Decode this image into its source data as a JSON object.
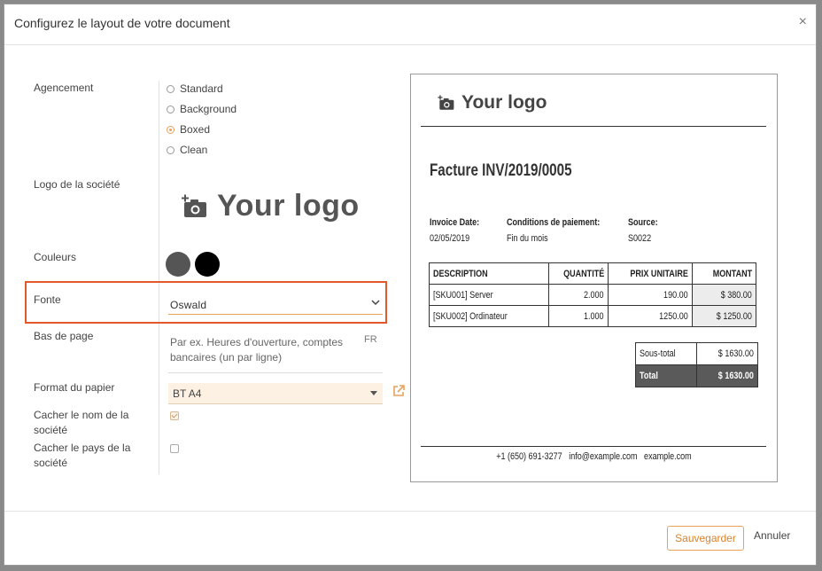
{
  "modal": {
    "title": "Configurez le layout de votre document",
    "close_icon": "×"
  },
  "form": {
    "layout": {
      "label": "Agencement",
      "options": [
        "Standard",
        "Background",
        "Boxed",
        "Clean"
      ],
      "selected": "Boxed"
    },
    "logo": {
      "label": "Logo de la société",
      "text": "Your logo",
      "icon": "camera-plus-icon"
    },
    "colors": {
      "label": "Couleurs",
      "primary": "#555555",
      "secondary": "#000000"
    },
    "font": {
      "label": "Fonte",
      "value": "Oswald"
    },
    "footer": {
      "label": "Bas de page",
      "placeholder": "Par ex. Heures d'ouverture, comptes bancaires (un par ligne)",
      "lang": "FR"
    },
    "paper_format": {
      "label": "Format du papier",
      "value": "BT A4"
    },
    "hide_company_name": {
      "label": "Cacher le nom de la société",
      "checked": true
    },
    "hide_company_country": {
      "label": "Cacher le pays de la société",
      "checked": false
    }
  },
  "preview": {
    "logo_text": "Your logo",
    "title": "Facture INV/2019/0005",
    "info": [
      {
        "header": "Invoice Date:",
        "value": "02/05/2019"
      },
      {
        "header": "Conditions de paiement:",
        "value": "Fin du mois"
      },
      {
        "header": "Source:",
        "value": "S0022"
      }
    ],
    "table": {
      "headers": [
        "DESCRIPTION",
        "QUANTITÉ",
        "PRIX UNITAIRE",
        "MONTANT"
      ],
      "rows": [
        [
          "[SKU001] Server",
          "2.000",
          "190.00",
          "$ 380.00"
        ],
        [
          "[SKU002] Ordinateur",
          "1.000",
          "1250.00",
          "$ 1250.00"
        ]
      ]
    },
    "totals": {
      "subtotal_label": "Sous-total",
      "subtotal_value": "$ 1630.00",
      "total_label": "Total",
      "total_value": "$ 1630.00"
    },
    "footer": "+1 (650) 691-3277   info@example.com   example.com"
  },
  "buttons": {
    "save": "Sauvegarder",
    "cancel": "Annuler"
  },
  "colors": {
    "accent": "#e8a15b",
    "highlight": "#e2582d"
  }
}
